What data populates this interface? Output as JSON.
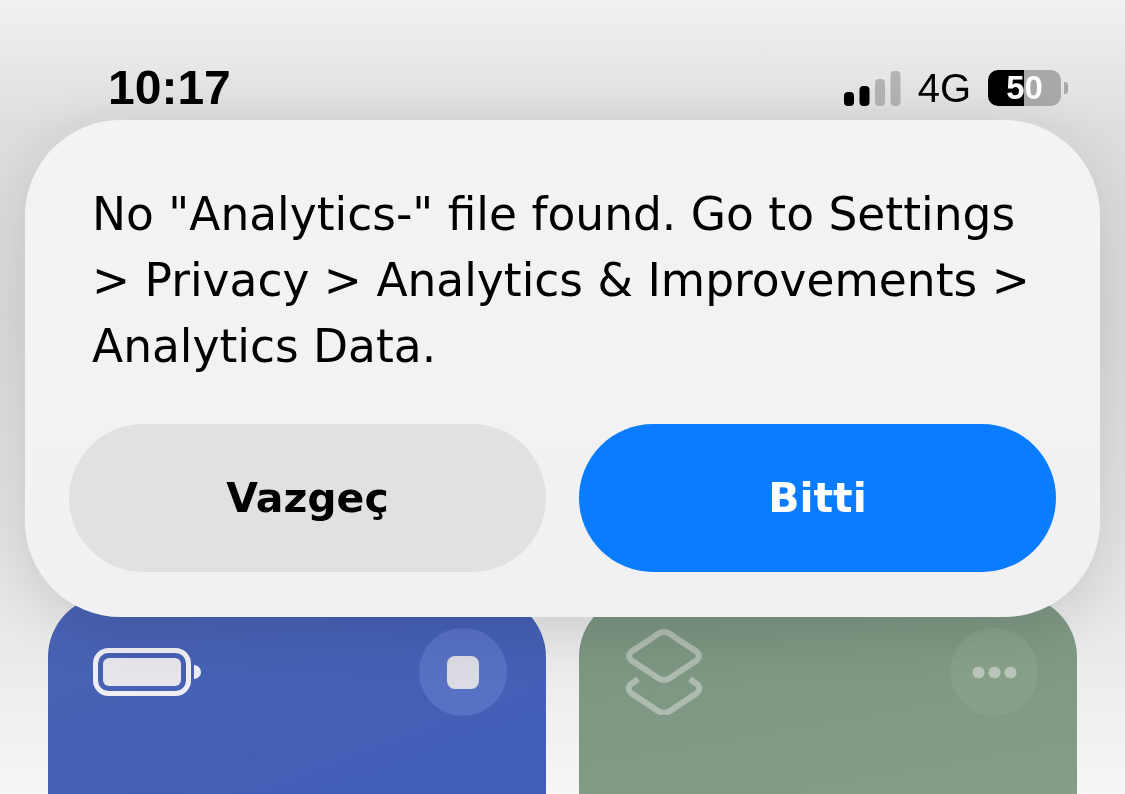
{
  "status_bar": {
    "time": "10:17",
    "network": "4G",
    "battery": "50"
  },
  "alert": {
    "message": "No \"Analytics-\" file found. Go to Settings > Privacy > Analytics & Improvements > Analytics Data.",
    "buttons": [
      {
        "label": "Vazgeç",
        "kind": "cancel"
      },
      {
        "label": "Bitti",
        "kind": "primary"
      }
    ]
  },
  "cards": [
    {
      "kind": "battery"
    },
    {
      "kind": "shortcuts"
    }
  ]
}
